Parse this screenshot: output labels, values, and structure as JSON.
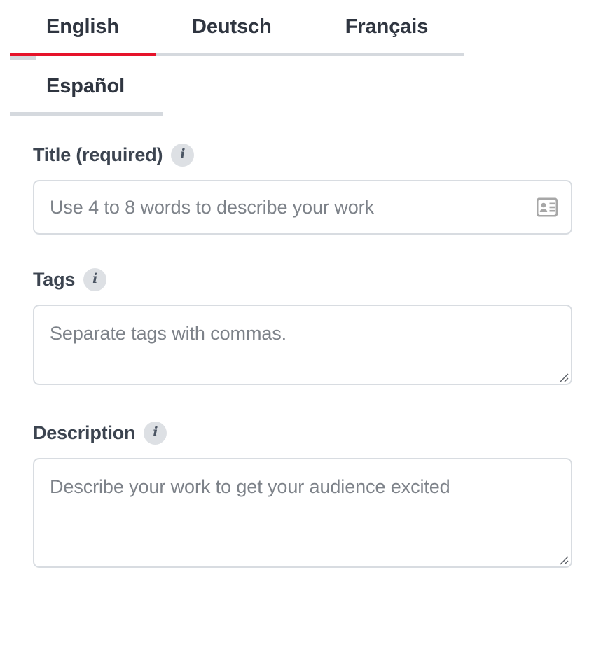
{
  "language_tabs": {
    "items": [
      {
        "label": "English",
        "active": true
      },
      {
        "label": "Deutsch",
        "active": false
      },
      {
        "label": "Français",
        "active": false
      },
      {
        "label": "Español",
        "active": false
      }
    ],
    "active_color": "#e6132a",
    "inactive_underline_color": "#d5d9de"
  },
  "form": {
    "fields": [
      {
        "label": "Title (required)",
        "info_icon": "info-icon",
        "placeholder": "Use 4 to 8 words to describe your work",
        "value": "",
        "type": "text",
        "trailing_icon": "contact-card-icon"
      },
      {
        "label": "Tags",
        "info_icon": "info-icon",
        "placeholder": "Separate tags with commas.",
        "value": "",
        "type": "textarea",
        "trailing_icon": "resize-grip-icon"
      },
      {
        "label": "Description",
        "info_icon": "info-icon",
        "placeholder": "Describe your work to get your audience excited",
        "value": "",
        "type": "textarea",
        "trailing_icon": "resize-grip-icon"
      }
    ]
  },
  "colors": {
    "accent_red": "#e6132a",
    "label_text": "#3c4450",
    "placeholder_text": "#7d8289",
    "border": "#d8dce1",
    "info_badge_bg": "#dde0e4"
  }
}
